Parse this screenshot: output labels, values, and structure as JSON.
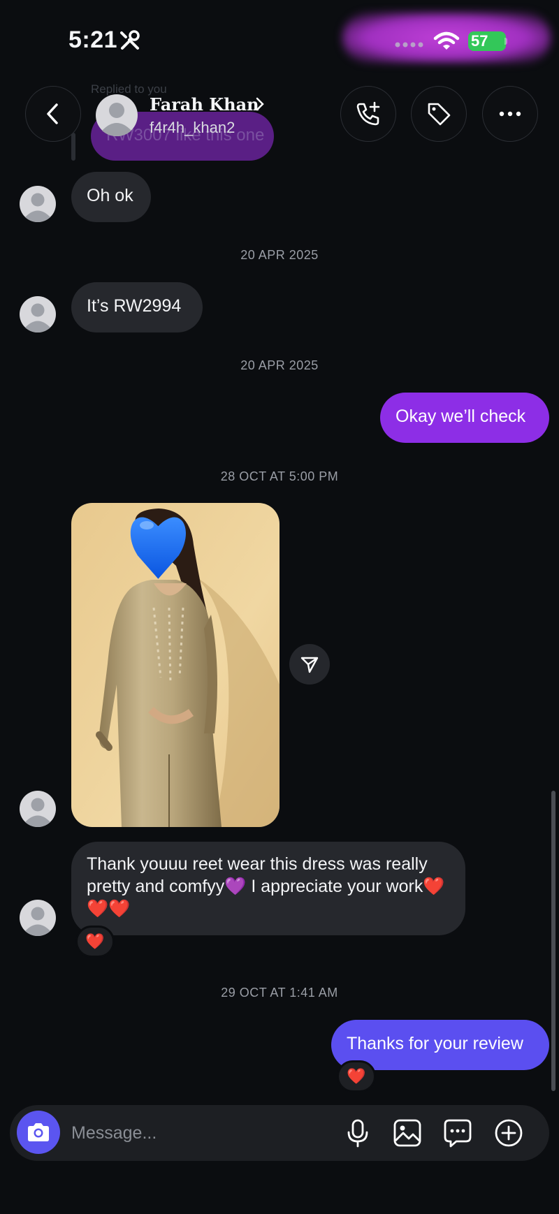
{
  "status_bar": {
    "time": "5:21",
    "battery": "57"
  },
  "header": {
    "name": "Farah Khan",
    "username": "f4r4h_khan2",
    "ghost_caption": "Replied to you",
    "ghost_message": "RW3007 like this one"
  },
  "messages": [
    {
      "id": "m1",
      "direction": "in",
      "text": "Oh ok"
    },
    {
      "id": "t1",
      "timestamp": "20 APR 2025"
    },
    {
      "id": "m2",
      "direction": "in",
      "text": "It’s RW2994"
    },
    {
      "id": "t2",
      "timestamp": "20 APR 2025"
    },
    {
      "id": "m3",
      "direction": "out",
      "text": "Okay we’ll check"
    },
    {
      "id": "t3",
      "timestamp": "28 OCT AT 5:00 PM"
    },
    {
      "id": "m4",
      "direction": "in",
      "type": "photo"
    },
    {
      "id": "m5",
      "direction": "in",
      "text": "Thank youuu reet wear this dress was really pretty and comfyy💜 I appreciate your work❤️❤️❤️",
      "reaction": "❤️"
    },
    {
      "id": "t4",
      "timestamp": "29 OCT AT 1:41 AM"
    },
    {
      "id": "m6",
      "direction": "out",
      "text": "Thanks for your review",
      "reaction": "❤️"
    }
  ],
  "composer": {
    "placeholder": "Message..."
  },
  "colors": {
    "background": "#0b0d10",
    "incoming_bubble": "#26282d",
    "outgoing_purple": "#8d2ee6",
    "outgoing_indigo": "#5b4ff0",
    "camera_button": "#5b55f0"
  },
  "icons": [
    "tools-icon",
    "wifi-icon",
    "back-icon",
    "phone-plus-icon",
    "tag-icon",
    "more-icon",
    "chevron-right-icon",
    "share-icon",
    "camera-icon",
    "mic-icon",
    "gallery-icon",
    "sticker-icon",
    "plus-icon"
  ]
}
